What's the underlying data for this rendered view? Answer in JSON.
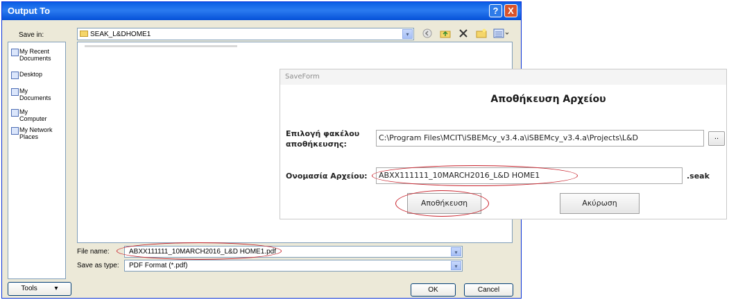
{
  "output_dialog": {
    "title": "Output To",
    "help_label": "?",
    "close_label": "X",
    "save_in_label": "Save in:",
    "save_in_value": "SEAK_L&DHOME1",
    "places": [
      {
        "label": "My Recent Documents",
        "line1": "My Recent",
        "line2": "Documents",
        "icon": "recent-documents-icon"
      },
      {
        "label": "Desktop",
        "line1": "Desktop",
        "line2": "",
        "icon": "desktop-icon"
      },
      {
        "label": "My Documents",
        "line1": "My",
        "line2": "Documents",
        "icon": "my-documents-icon"
      },
      {
        "label": "My Computer",
        "line1": "My",
        "line2": "Computer",
        "icon": "my-computer-icon"
      },
      {
        "label": "My Network Places",
        "line1": "My Network",
        "line2": "Places",
        "icon": "network-places-icon"
      }
    ],
    "file_name_label": "File name:",
    "file_name_value": "ABXX111111_10MARCH2016_L&D HOME1.pdf",
    "save_as_type_label": "Save as type:",
    "save_as_type_value": "PDF Format (*.pdf)",
    "tools_label": "Tools",
    "ok_label": "OK",
    "cancel_label": "Cancel",
    "toolbar_icons": [
      "back-icon",
      "up-folder-icon",
      "delete-icon",
      "new-folder-icon",
      "views-menu-icon"
    ],
    "dropdown_glyph": "▾"
  },
  "save_form": {
    "title": "SaveForm",
    "heading": "Αποθήκευση Αρχείου",
    "folder_label_line1": "Επιλογή φακέλου",
    "folder_label_line2": "αποθήκευσης:",
    "folder_path": "C:\\Program Files\\MCIT\\iSBEMcy_v3.4.a\\iSBEMcy_v3.4.a\\Projects\\L&D",
    "browse_label": "..",
    "filename_label": "Ονομασία Αρχείου:",
    "filename_value": "ABXX111111_10MARCH2016_L&D HOME1",
    "extension": ".seak",
    "save_button": "Αποθήκευση",
    "cancel_button": "Ακύρωση"
  },
  "colors": {
    "xp_title": "#0a5ee4",
    "xp_face": "#ece9d8",
    "highlight_oval": "#c8202a"
  }
}
